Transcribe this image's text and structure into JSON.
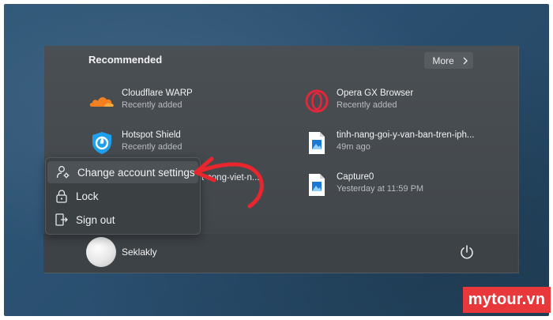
{
  "start_menu": {
    "recommended_title": "Recommended",
    "more_label": "More",
    "items": [
      {
        "name": "Cloudflare WARP",
        "sub": "Recently added",
        "icon": "cloudflare-icon"
      },
      {
        "name": "Opera GX Browser",
        "sub": "Recently added",
        "icon": "opera-gx-icon"
      },
      {
        "name": "Hotspot Shield",
        "sub": "Recently added",
        "icon": "hotspot-shield-icon"
      },
      {
        "name": "tinh-nang-goi-y-van-ban-tren-iph...",
        "sub": "49m ago",
        "icon": "image-file-icon"
      },
      {
        "name": "Capture0",
        "sub": "Yesterday at 11:59 PM",
        "icon": "image-file-icon"
      }
    ],
    "obscured_item_text": "t-cong-viet-n...",
    "user_name": "Seklakly"
  },
  "account_menu": {
    "items": [
      {
        "label": "Change account settings",
        "icon": "account-settings-icon"
      },
      {
        "label": "Lock",
        "icon": "lock-icon"
      },
      {
        "label": "Sign out",
        "icon": "sign-out-icon"
      }
    ]
  },
  "watermark": {
    "text": "mytour.vn"
  },
  "colors": {
    "arrow": "#e8262d",
    "logo_bg": "#e8383b",
    "background": "#2a4f70"
  }
}
